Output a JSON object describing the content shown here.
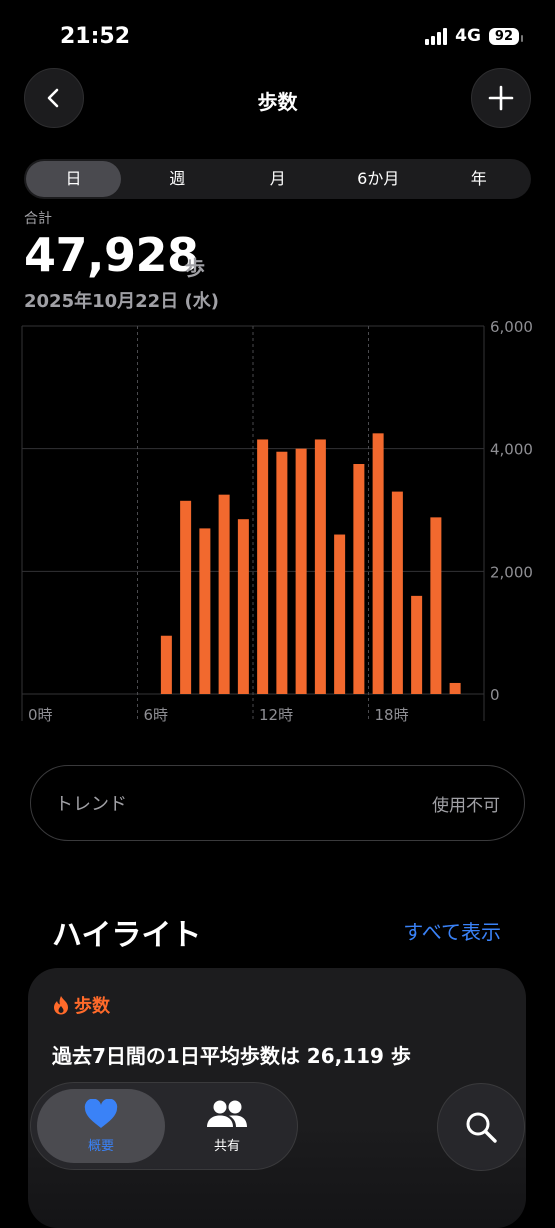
{
  "status": {
    "time": "21:52",
    "network": "4G",
    "battery": "92"
  },
  "header": {
    "title": "歩数"
  },
  "segments": [
    "日",
    "週",
    "月",
    "6か月",
    "年"
  ],
  "summary": {
    "label": "合計",
    "value": "47,928",
    "unit": "歩",
    "date": "2025年10月22日 (水)"
  },
  "chart_data": {
    "type": "bar",
    "x_tick_labels": [
      "0時",
      "6時",
      "12時",
      "18時"
    ],
    "y_tick_labels": [
      "6,000",
      "4,000",
      "2,000",
      "0"
    ],
    "ylim": [
      0,
      6000
    ],
    "bar_color": "#f2692e",
    "categories": [
      "0",
      "1",
      "2",
      "3",
      "4",
      "5",
      "6",
      "7",
      "8",
      "9",
      "10",
      "11",
      "12",
      "13",
      "14",
      "15",
      "16",
      "17",
      "18",
      "19",
      "20",
      "21",
      "22",
      "23"
    ],
    "values": [
      0,
      0,
      0,
      0,
      0,
      0,
      0,
      950,
      3150,
      2700,
      3250,
      2850,
      4150,
      3950,
      4000,
      4150,
      2600,
      3750,
      4250,
      3300,
      1600,
      2880,
      180,
      0
    ]
  },
  "trend": {
    "label": "トレンド",
    "value": "使用不可"
  },
  "highlights": {
    "title": "ハイライト",
    "show_all": "すべて表示",
    "card": {
      "category": "歩数",
      "text": "過去7日間の1日平均歩数は 26,119 歩"
    }
  },
  "tabbar": {
    "summary": "概要",
    "sharing": "共有"
  },
  "colors": {
    "accent": "#3a82f7",
    "steps": "#f2692e"
  },
  "icons": {
    "back": "chevron-left-icon",
    "add": "plus-icon",
    "flame": "flame-icon",
    "heart": "heart-icon",
    "people": "people-icon",
    "search": "search-icon"
  }
}
